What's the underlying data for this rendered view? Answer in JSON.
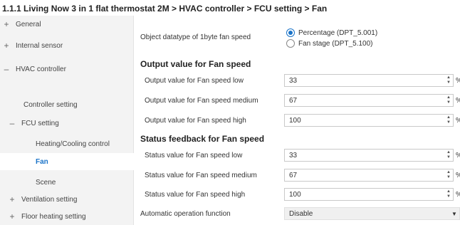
{
  "breadcrumb": "1.1.1 Living Now 3 in 1 flat thermostat 2M > HVAC controller > FCU setting > Fan",
  "sidebar": {
    "items": [
      {
        "label": "General",
        "expander": "+",
        "level": 0
      },
      {
        "label": "Internal sensor",
        "expander": "+",
        "level": 0
      },
      {
        "label": "HVAC controller",
        "expander": "–",
        "level": 0
      },
      {
        "label": "Controller setting",
        "expander": "",
        "level": 1
      },
      {
        "label": "FCU setting",
        "expander": "–",
        "level": 1
      },
      {
        "label": "Heating/Cooling control",
        "expander": "",
        "level": 2
      },
      {
        "label": "Fan",
        "expander": "",
        "level": 2,
        "active": true
      },
      {
        "label": "Scene",
        "expander": "",
        "level": 2
      },
      {
        "label": "Ventilation setting",
        "expander": "+",
        "level": 1
      },
      {
        "label": "Floor heating setting",
        "expander": "+",
        "level": 1
      }
    ]
  },
  "main": {
    "datatype": {
      "label": "Object datatype of 1byte fan speed",
      "options": [
        "Percentage (DPT_5.001)",
        "Fan stage (DPT_5.100)"
      ],
      "selected": 0
    },
    "output_section": {
      "title": "Output value for Fan speed",
      "rows": [
        {
          "label": "Output value for Fan speed low",
          "value": "33",
          "unit": "%"
        },
        {
          "label": "Output value for Fan speed medium",
          "value": "67",
          "unit": "%"
        },
        {
          "label": "Output value for Fan speed high",
          "value": "100",
          "unit": "%"
        }
      ]
    },
    "status_section": {
      "title": "Status feedback for Fan speed",
      "rows": [
        {
          "label": "Status value for Fan speed low",
          "value": "33",
          "unit": "%"
        },
        {
          "label": "Status value for Fan speed medium",
          "value": "67",
          "unit": "%"
        },
        {
          "label": "Status value for Fan speed high",
          "value": "100",
          "unit": "%"
        }
      ]
    },
    "automatic": {
      "label": "Automatic operation function",
      "value": "Disable"
    }
  },
  "icons": {
    "spin_up": "▲",
    "spin_down": "▼",
    "caret": "▼"
  },
  "colors": {
    "accent": "#1a73c8",
    "sidebar_bg": "#f3f3f3"
  }
}
